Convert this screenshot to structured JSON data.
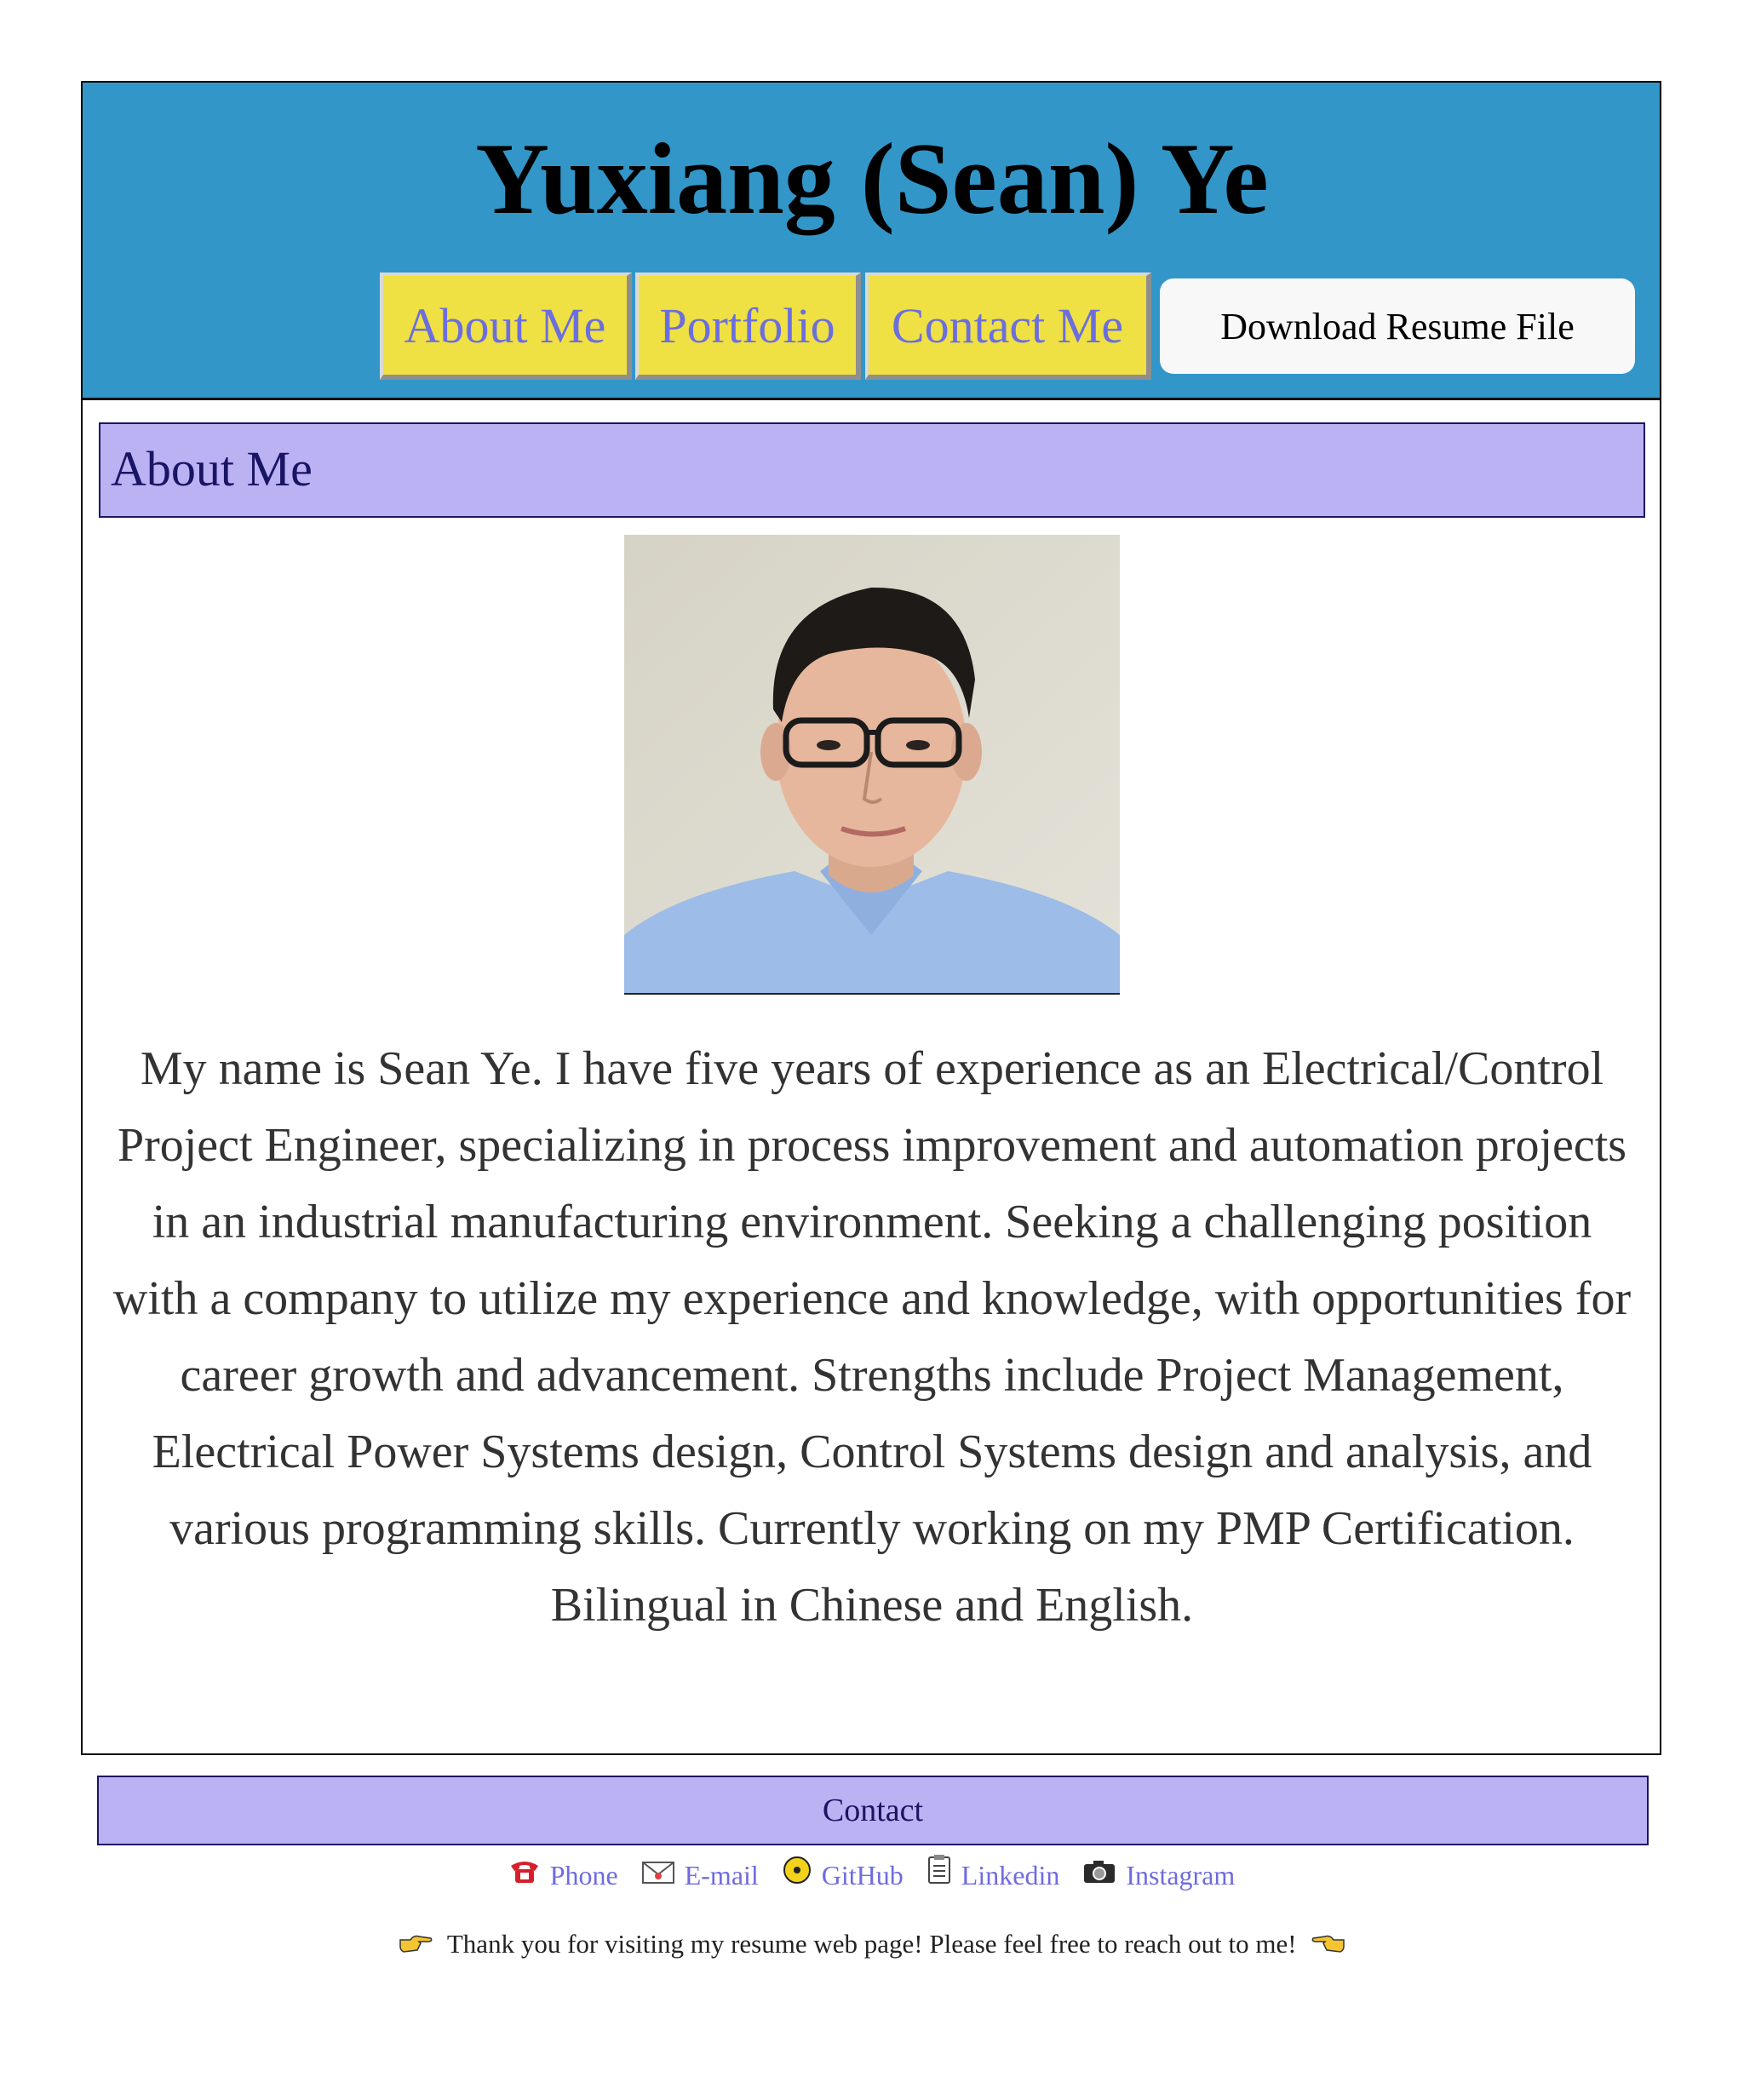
{
  "header": {
    "title": "Yuxiang (Sean) Ye",
    "bg_color": "#3396c8"
  },
  "nav": {
    "items": [
      {
        "label": "About Me"
      },
      {
        "label": "Portfolio"
      },
      {
        "label": "Contact Me"
      }
    ],
    "button_color": "#efe043",
    "link_color": "#6b6ede",
    "download_label": "Download Resume File"
  },
  "about": {
    "heading": "About Me",
    "heading_bg": "#bbb2f3",
    "photo_icon": "profile-photo",
    "bio": "My name is Sean Ye. I have five years of experience as an Electrical/Control Project Engineer, specializing in process improvement and automation projects in an industrial manufacturing environment. Seeking a challenging position with a company to utilize my experience and knowledge, with opportunities for career growth and advancement. Strengths include Project Management, Electrical Power Systems design, Control Systems design and analysis, and various programming skills. Currently working on my PMP Certification. Bilingual in Chinese and English."
  },
  "contact": {
    "heading": "Contact",
    "links": [
      {
        "label": "Phone",
        "icon": "telephone-icon"
      },
      {
        "label": "E-mail",
        "icon": "envelope-icon"
      },
      {
        "label": "GitHub",
        "icon": "disc-icon"
      },
      {
        "label": "Linkedin",
        "icon": "clipboard-icon"
      },
      {
        "label": "Instagram",
        "icon": "camera-icon"
      }
    ]
  },
  "footer": {
    "thanks": "Thank you for visiting my resume web page! Please feel free to reach out to me!"
  }
}
